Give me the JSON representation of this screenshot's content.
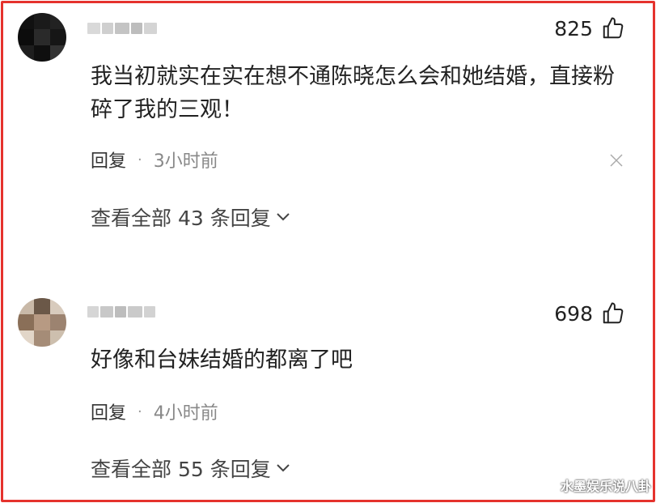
{
  "comments": [
    {
      "likes": "825",
      "text": "我当初就实在实在想不通陈晓怎么会和她结婚，直接粉碎了我的三观！",
      "reply_label": "回复",
      "separator": "·",
      "time": "3小时前",
      "view_replies": "查看全部 43 条回复"
    },
    {
      "likes": "698",
      "text": "好像和台妹结婚的都离了吧",
      "reply_label": "回复",
      "separator": "·",
      "time": "4小时前",
      "view_replies": "查看全部 55 条回复"
    }
  ],
  "watermark": "水墨娱乐说八卦",
  "colors": {
    "frame": "#e5322d",
    "text": "#222222",
    "muted": "#888888"
  },
  "icons": {
    "like": "thumbs-up-icon",
    "close": "close-icon",
    "expand": "chevron-down-icon"
  }
}
